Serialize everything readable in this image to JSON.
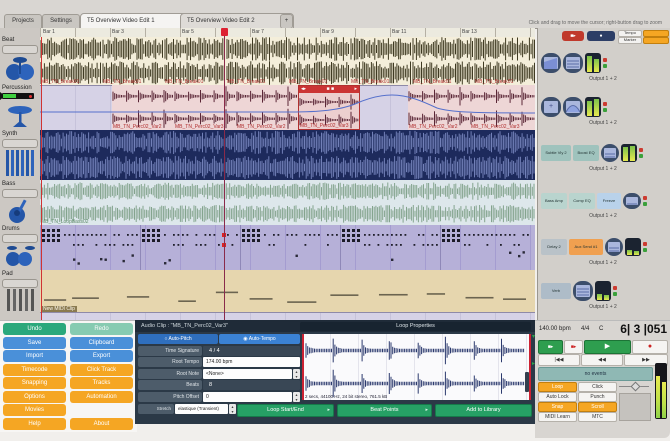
{
  "window": {
    "projects": "Projects",
    "settings": "Settings",
    "tab1": "T5 Overview Video Edit 1",
    "tab2": "T5 Overview Video Edit 2",
    "close": "×",
    "new_tab": "+",
    "tooltip": "Click and drag to move the cursor; right-button drag to zoom",
    "tempo_toggle": "Tempo",
    "marker_toggle": "Marker"
  },
  "ruler": [
    "Bar 1",
    "Bar 3",
    "Bar 5",
    "Bar 7",
    "Bar 9",
    "Bar 11",
    "Bar 13"
  ],
  "tracks": {
    "beat": {
      "name": "Beat",
      "clip": "MB_TN_Break01",
      "output": "Output 1 + 2"
    },
    "percussion": {
      "name": "Percussion",
      "clips": [
        "MB_TN_Perc02_Var2",
        "MB_TN_Perc02_Var3",
        "MB_TN_Perc02_Var2",
        "MB_TN_Perc02_Var3",
        "MB_TN_Perc02_Var2",
        "MB_TN_Perc02_Var3"
      ],
      "output": "Output 1 + 2"
    },
    "synth": {
      "name": "Synth",
      "plugins": [
        "Subtle Vly 2",
        "Boost EQ"
      ],
      "output": "Output 1 + 2"
    },
    "bass": {
      "name": "Bass",
      "clip": "MB_TN_LoopBass02",
      "plugins": [
        "Bass Amp",
        "Comp EQ",
        "Freeze"
      ],
      "output": "Output 1 + 2"
    },
    "drums": {
      "name": "Drums",
      "plugins": [
        "Delay 2",
        "Aux Send #1"
      ],
      "output": "Output 1 + 2"
    },
    "pad": {
      "name": "Pad",
      "clip": "New MIDI Clip",
      "plugins": [
        "Verb"
      ],
      "output": "Output 1 + 2"
    }
  },
  "menu": {
    "rows": [
      [
        "Undo",
        "Redo"
      ],
      [
        "Save",
        "Clipboard"
      ],
      [
        "Import",
        "Export"
      ],
      [
        "Timecode",
        "Click Track"
      ],
      [
        "Snapping",
        "Tracks"
      ],
      [
        "Options",
        "Automation"
      ],
      [
        "Movies",
        ""
      ],
      [
        "Help",
        "About"
      ]
    ]
  },
  "properties": {
    "header": "Audio Clip : \"MB_TN_Perc02_Var3\"",
    "loop_header": "Loop Properties",
    "auto_pitch": "Auto-Pitch",
    "auto_tempo": "Auto-Tempo",
    "time_signature_label": "Time Signature",
    "time_signature": "4  /  4",
    "root_tempo_label": "Root Tempo",
    "root_tempo": "174.00 bpm",
    "root_note_label": "Root Note",
    "root_note": "<None>",
    "beats_label": "Beats",
    "beats": "8",
    "pitch_label": "Pitch Offset",
    "pitch": "0",
    "stretch_label": "Stretch",
    "stretch": "elastique (Transient)",
    "info": "2 secs, 44100 Hz, 24 bit stereo, 761.5 kB",
    "loop_btn": "Loop Start/End",
    "beat_btn": "Beat Points",
    "library_btn": "Add to Library"
  },
  "transport": {
    "tempo": "140.00 bpm",
    "time_sig": "4/4",
    "key": "C",
    "position": "6| 3 |051",
    "display": "no events",
    "grid": [
      [
        "Loop",
        "Click"
      ],
      [
        "Auto Lock",
        "Punch"
      ],
      [
        "Snap",
        "Scroll"
      ],
      [
        "MIDI Learn",
        "MTC"
      ]
    ]
  }
}
